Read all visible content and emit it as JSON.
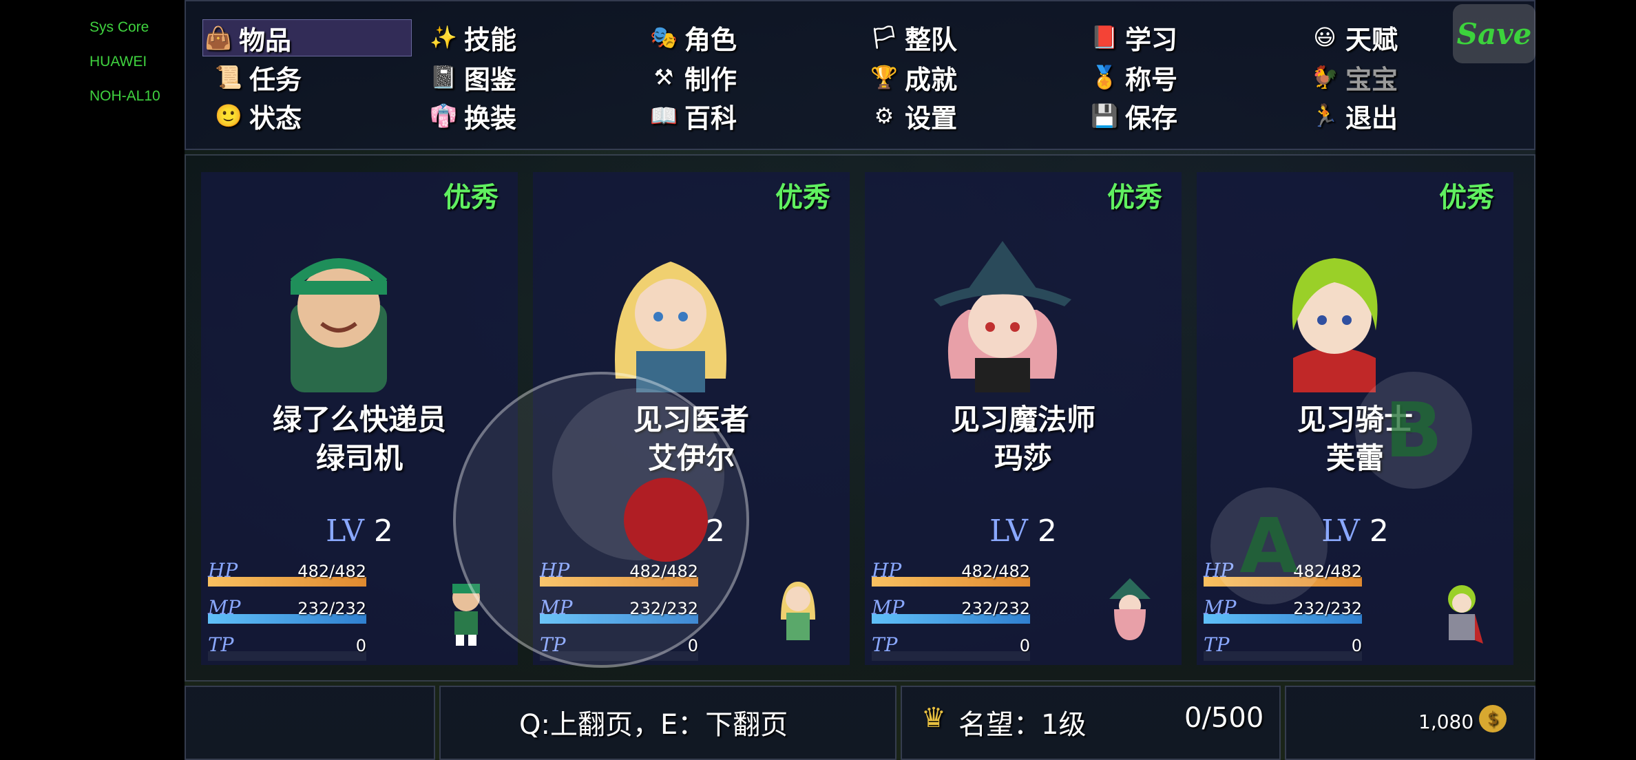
{
  "system_overlay": [
    "Sys Core",
    "HUAWEI",
    "NOH-AL10"
  ],
  "menu": {
    "items": [
      {
        "label": "物品",
        "icon": "bag-icon",
        "state": "selected"
      },
      {
        "label": "技能",
        "icon": "skill-icon"
      },
      {
        "label": "角色",
        "icon": "mask-icon"
      },
      {
        "label": "整队",
        "icon": "flag-icon"
      },
      {
        "label": "学习",
        "icon": "book-icon"
      },
      {
        "label": "天赋",
        "icon": "talent-icon"
      },
      {
        "label": "任务",
        "icon": "scroll-icon"
      },
      {
        "label": "图鉴",
        "icon": "album-icon"
      },
      {
        "label": "制作",
        "icon": "anvil-icon"
      },
      {
        "label": "成就",
        "icon": "trophy-icon"
      },
      {
        "label": "称号",
        "icon": "medal-icon"
      },
      {
        "label": "宝宝",
        "icon": "pet-icon",
        "state": "disabled"
      },
      {
        "label": "状态",
        "icon": "status-icon"
      },
      {
        "label": "换装",
        "icon": "outfit-icon"
      },
      {
        "label": "百科",
        "icon": "encyclopedia-icon"
      },
      {
        "label": "设置",
        "icon": "gear-icon"
      },
      {
        "label": "保存",
        "icon": "floppy-icon"
      },
      {
        "label": "退出",
        "icon": "exit-icon"
      }
    ],
    "save_button": "Save"
  },
  "party": [
    {
      "quality": "优秀",
      "job": "绿了么快递员",
      "name": "绿司机",
      "lv_label": "LV",
      "level": "2",
      "hp_label": "HP",
      "hp": "482/482",
      "hp_ratio": 1,
      "mp_label": "MP",
      "mp": "232/232",
      "mp_ratio": 1,
      "tp_label": "TP",
      "tp": "0",
      "tp_ratio": 0
    },
    {
      "quality": "优秀",
      "job": "见习医者",
      "name": "艾伊尔",
      "lv_label": "LV",
      "level": "2",
      "hp_label": "HP",
      "hp": "482/482",
      "hp_ratio": 1,
      "mp_label": "MP",
      "mp": "232/232",
      "mp_ratio": 1,
      "tp_label": "TP",
      "tp": "0",
      "tp_ratio": 0
    },
    {
      "quality": "优秀",
      "job": "见习魔法师",
      "name": "玛莎",
      "lv_label": "LV",
      "level": "2",
      "hp_label": "HP",
      "hp": "482/482",
      "hp_ratio": 1,
      "mp_label": "MP",
      "mp": "232/232",
      "mp_ratio": 1,
      "tp_label": "TP",
      "tp": "0",
      "tp_ratio": 0
    },
    {
      "quality": "优秀",
      "job": "见习骑士",
      "name": "芙蕾",
      "lv_label": "LV",
      "level": "2",
      "hp_label": "HP",
      "hp": "482/482",
      "hp_ratio": 1,
      "mp_label": "MP",
      "mp": "232/232",
      "mp_ratio": 1,
      "tp_label": "TP",
      "tp": "0",
      "tp_ratio": 0
    }
  ],
  "controls": {
    "button_b": "B",
    "button_a": "A"
  },
  "footer": {
    "paging_hint": "Q:上翻页，E：下翻页",
    "reputation": "名望：1级",
    "progress": "0/500",
    "gold": "1,080"
  },
  "colors": {
    "quality": "#60f060",
    "hp_bar": "#f0a040",
    "mp_bar": "#40a8e8",
    "save_text": "#3cd23c"
  }
}
